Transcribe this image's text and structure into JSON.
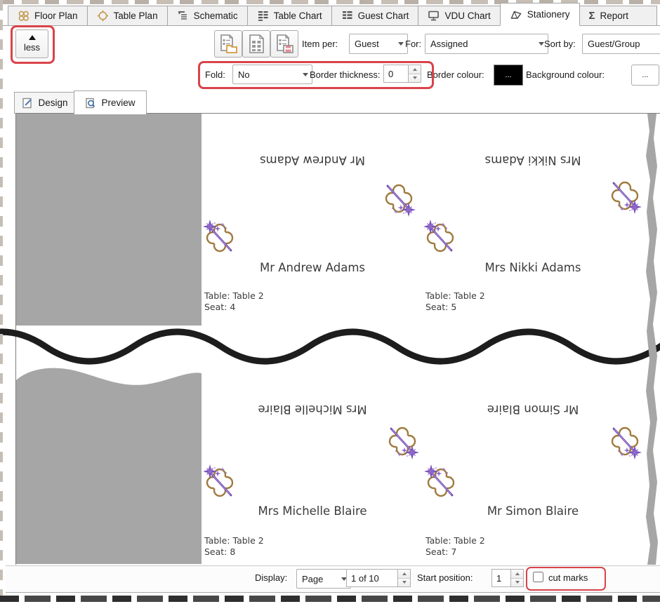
{
  "tabs": [
    {
      "label": "Floor Plan"
    },
    {
      "label": "Table Plan"
    },
    {
      "label": "Schematic"
    },
    {
      "label": "Table Chart"
    },
    {
      "label": "Guest Chart"
    },
    {
      "label": "VDU Chart"
    },
    {
      "label": "Stationery"
    },
    {
      "label": "Report",
      "icon_glyph": "Σ"
    }
  ],
  "toolbar": {
    "less_label": "less",
    "item_per_label": "Item per:",
    "item_per_value": "Guest",
    "for_label": "For:",
    "for_value": "Assigned",
    "sort_by_label": "Sort by:",
    "sort_by_value": "Guest/Group",
    "fold_label": "Fold:",
    "fold_value": "No",
    "border_thickness_label": "Border thickness:",
    "border_thickness_value": "0",
    "border_colour_label": "Border colour:",
    "border_colour_button": "...",
    "background_colour_label": "Background colour:",
    "background_colour_button": "..."
  },
  "view_tabs": {
    "design_label": "Design",
    "preview_label": "Preview"
  },
  "preview": {
    "sections": [
      {
        "cards": [
          {
            "name": "Mr Andrew Adams",
            "table": "Table: Table 2",
            "seat": "Seat: 4"
          },
          {
            "name": "Mrs Nikki Adams",
            "table": "Table: Table 2",
            "seat": "Seat: 5"
          }
        ]
      },
      {
        "cards": [
          {
            "name": "Mrs Michelle Blaire",
            "table": "Table: Table 2",
            "seat": "Seat: 8"
          },
          {
            "name": "Mr Simon Blaire",
            "table": "Table: Table 2",
            "seat": "Seat: 7"
          }
        ]
      }
    ]
  },
  "bottom_bar": {
    "display_label": "Display:",
    "display_value": "Page",
    "page_value": "1 of 10",
    "start_position_label": "Start position:",
    "start_position_value": "1",
    "cut_marks_label": "cut marks",
    "cut_marks_checked": false
  },
  "colors": {
    "annotation": "#d9434a",
    "page_gray": "#a6a6a6",
    "tear": "#1d1d1d"
  }
}
